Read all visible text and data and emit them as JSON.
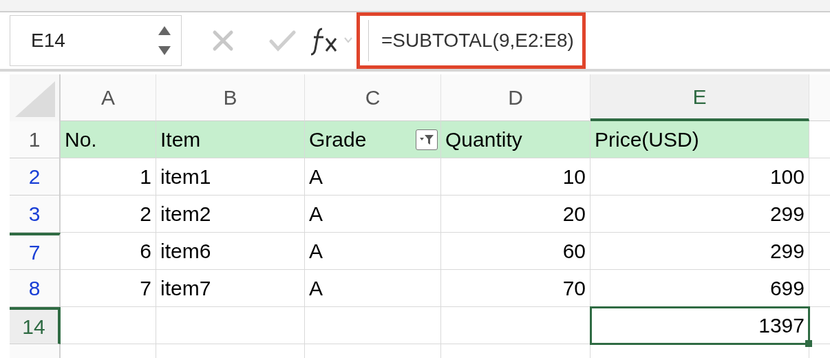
{
  "formula_bar": {
    "name_box": "E14",
    "formula": "=SUBTOTAL(9,E2:E8)",
    "formula_highlighted": true
  },
  "columns": [
    {
      "label": "A",
      "selected": false
    },
    {
      "label": "B",
      "selected": false
    },
    {
      "label": "C",
      "selected": false
    },
    {
      "label": "D",
      "selected": false
    },
    {
      "label": "E",
      "selected": true
    }
  ],
  "rows": [
    {
      "number": "1",
      "kind": "header",
      "filtered": false,
      "selected": false,
      "hidden_rows_above": false,
      "cells": [
        {
          "value": "No.",
          "kind": "text"
        },
        {
          "value": "Item",
          "kind": "text"
        },
        {
          "value": "Grade",
          "kind": "text",
          "filter": true
        },
        {
          "value": "Quantity",
          "kind": "text"
        },
        {
          "value": "Price(USD)",
          "kind": "text"
        }
      ]
    },
    {
      "number": "2",
      "kind": "data",
      "filtered": true,
      "selected": false,
      "hidden_rows_above": false,
      "cells": [
        {
          "value": "1",
          "kind": "number"
        },
        {
          "value": "item1",
          "kind": "text"
        },
        {
          "value": "A",
          "kind": "text"
        },
        {
          "value": "10",
          "kind": "number"
        },
        {
          "value": "100",
          "kind": "number"
        }
      ]
    },
    {
      "number": "3",
      "kind": "data",
      "filtered": true,
      "selected": false,
      "hidden_rows_above": false,
      "cells": [
        {
          "value": "2",
          "kind": "number"
        },
        {
          "value": "item2",
          "kind": "text"
        },
        {
          "value": "A",
          "kind": "text"
        },
        {
          "value": "20",
          "kind": "number"
        },
        {
          "value": "299",
          "kind": "number"
        }
      ]
    },
    {
      "number": "7",
      "kind": "data",
      "filtered": true,
      "selected": false,
      "hidden_rows_above": true,
      "cells": [
        {
          "value": "6",
          "kind": "number"
        },
        {
          "value": "item6",
          "kind": "text"
        },
        {
          "value": "A",
          "kind": "text"
        },
        {
          "value": "60",
          "kind": "number"
        },
        {
          "value": "299",
          "kind": "number"
        }
      ]
    },
    {
      "number": "8",
      "kind": "data",
      "filtered": true,
      "selected": false,
      "hidden_rows_above": false,
      "cells": [
        {
          "value": "7",
          "kind": "number"
        },
        {
          "value": "item7",
          "kind": "text"
        },
        {
          "value": "A",
          "kind": "text"
        },
        {
          "value": "70",
          "kind": "number"
        },
        {
          "value": "699",
          "kind": "number"
        }
      ]
    },
    {
      "number": "14",
      "kind": "data",
      "filtered": false,
      "selected": true,
      "hidden_rows_above": true,
      "cells": [
        {
          "kind": "text"
        },
        {
          "kind": "text"
        },
        {
          "kind": "text"
        },
        {
          "kind": "text"
        },
        {
          "value": "1397",
          "kind": "number",
          "selected": true
        }
      ]
    }
  ]
}
